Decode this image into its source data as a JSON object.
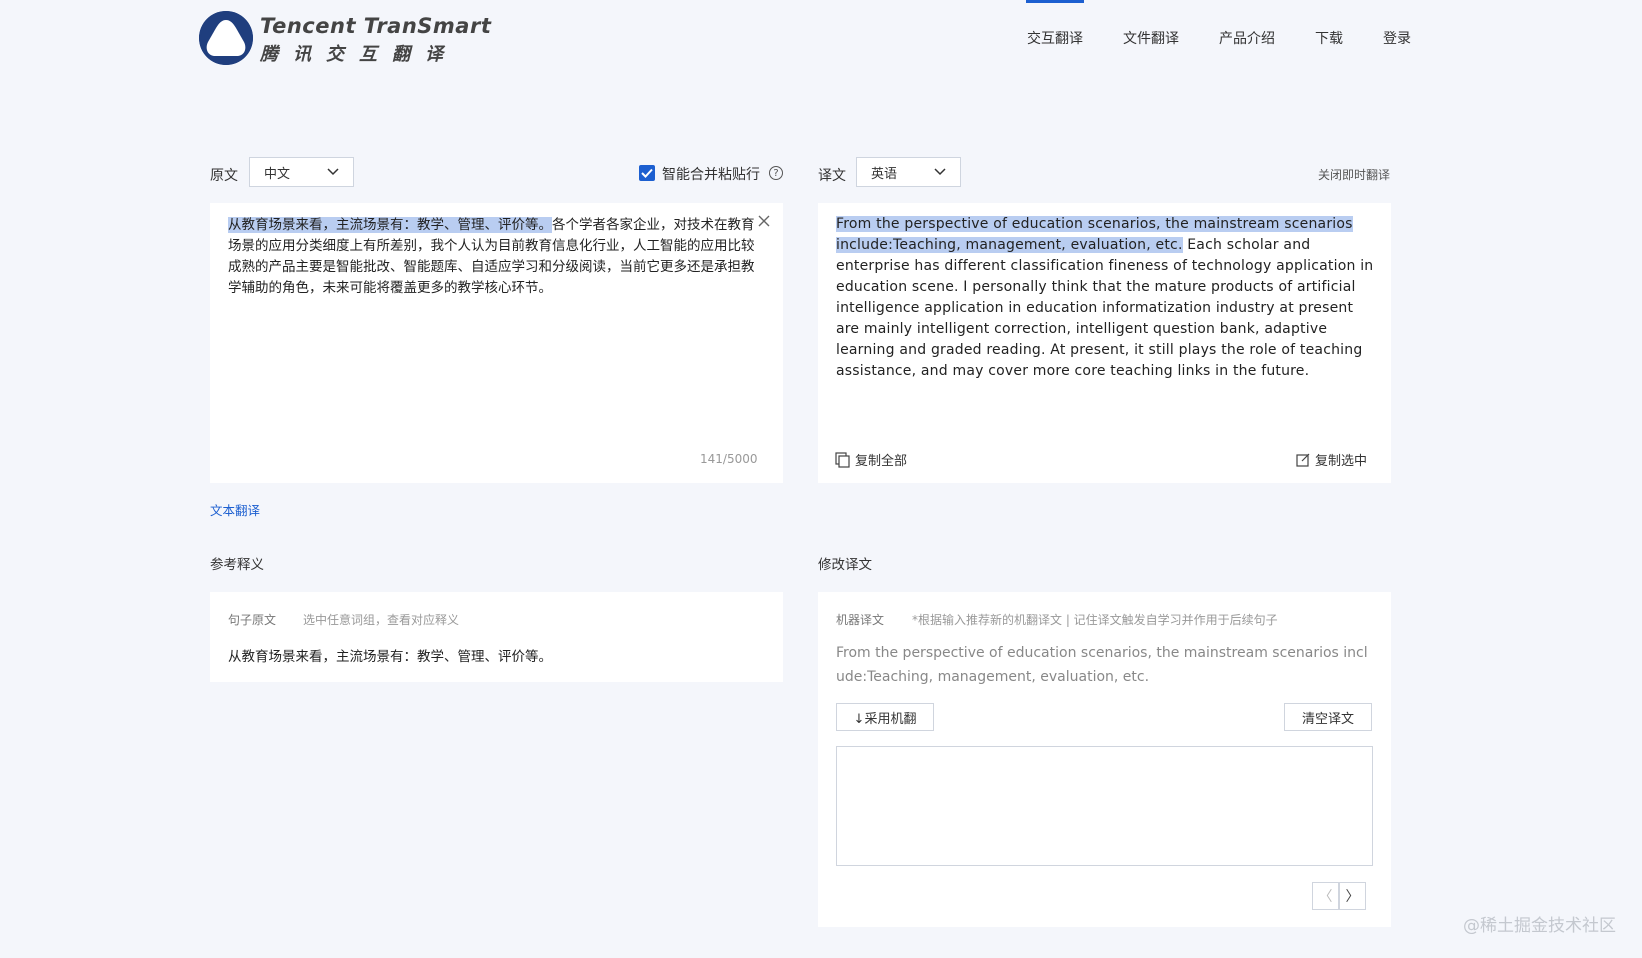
{
  "brand": {
    "name_en": "Tencent TranSmart",
    "name_cn": "腾讯交互翻译"
  },
  "nav": {
    "items": [
      "交互翻译",
      "文件翻译",
      "产品介绍",
      "下载",
      "登录"
    ],
    "active_index": 0
  },
  "source": {
    "label": "原文",
    "language": "中文",
    "merge_label": "智能合并粘贴行",
    "merge_checked": true,
    "text_highlighted": "从教育场景来看，主流场景有：教学、管理、评价等。",
    "text_rest": "各个学者各家企业，对技术在教育场景的应用分类细度上有所差别，我个人认为目前教育信息化行业，人工智能的应用比较成熟的产品主要是智能批改、智能题库、自适应学习和分级阅读，当前它更多还是承担教学辅助的角色，未来可能将覆盖更多的教学核心环节。",
    "counter": "141/5000"
  },
  "target": {
    "label": "译文",
    "language": "英语",
    "toggle_instant": "关闭即时翻译",
    "text_highlighted": "From the perspective of education scenarios, the mainstream scenarios include:Teaching, management, evaluation, etc.",
    "text_rest": " Each scholar and enterprise has different classification fineness of technology application in education scene. I personally think that the mature products of artificial intelligence application in education informatization industry at present are mainly intelligent correction, intelligent question bank, adaptive learning and graded reading. At present, it still plays the role of teaching assistance, and may cover more core teaching links in the future.",
    "copy_all": "复制全部",
    "copy_selected": "复制选中"
  },
  "text_translate_link": "文本翻译",
  "reference": {
    "title": "参考释义",
    "tab_sentence": "句子原文",
    "hint": "选中任意词组，查看对应释义",
    "sentence": "从教育场景来看，主流场景有：教学、管理、评价等。"
  },
  "revise": {
    "title": "修改译文",
    "machine_label": "机器译文",
    "hint": "*根据输入推荐新的机翻译文 | 记住译文触发自学习并作用于后续句子",
    "machine_text": "From the perspective of education scenarios, the mainstream scenarios include:Teaching, management, evaluation, etc.",
    "adopt_button": "↓采用机翻",
    "clear_button": "清空译文",
    "prev": "〈",
    "next": "〉"
  },
  "watermark": "@稀土掘金技术社区",
  "colors": {
    "accent": "#1c5fd0",
    "highlight": "#b9cdf1",
    "background": "#f4f6fb"
  }
}
